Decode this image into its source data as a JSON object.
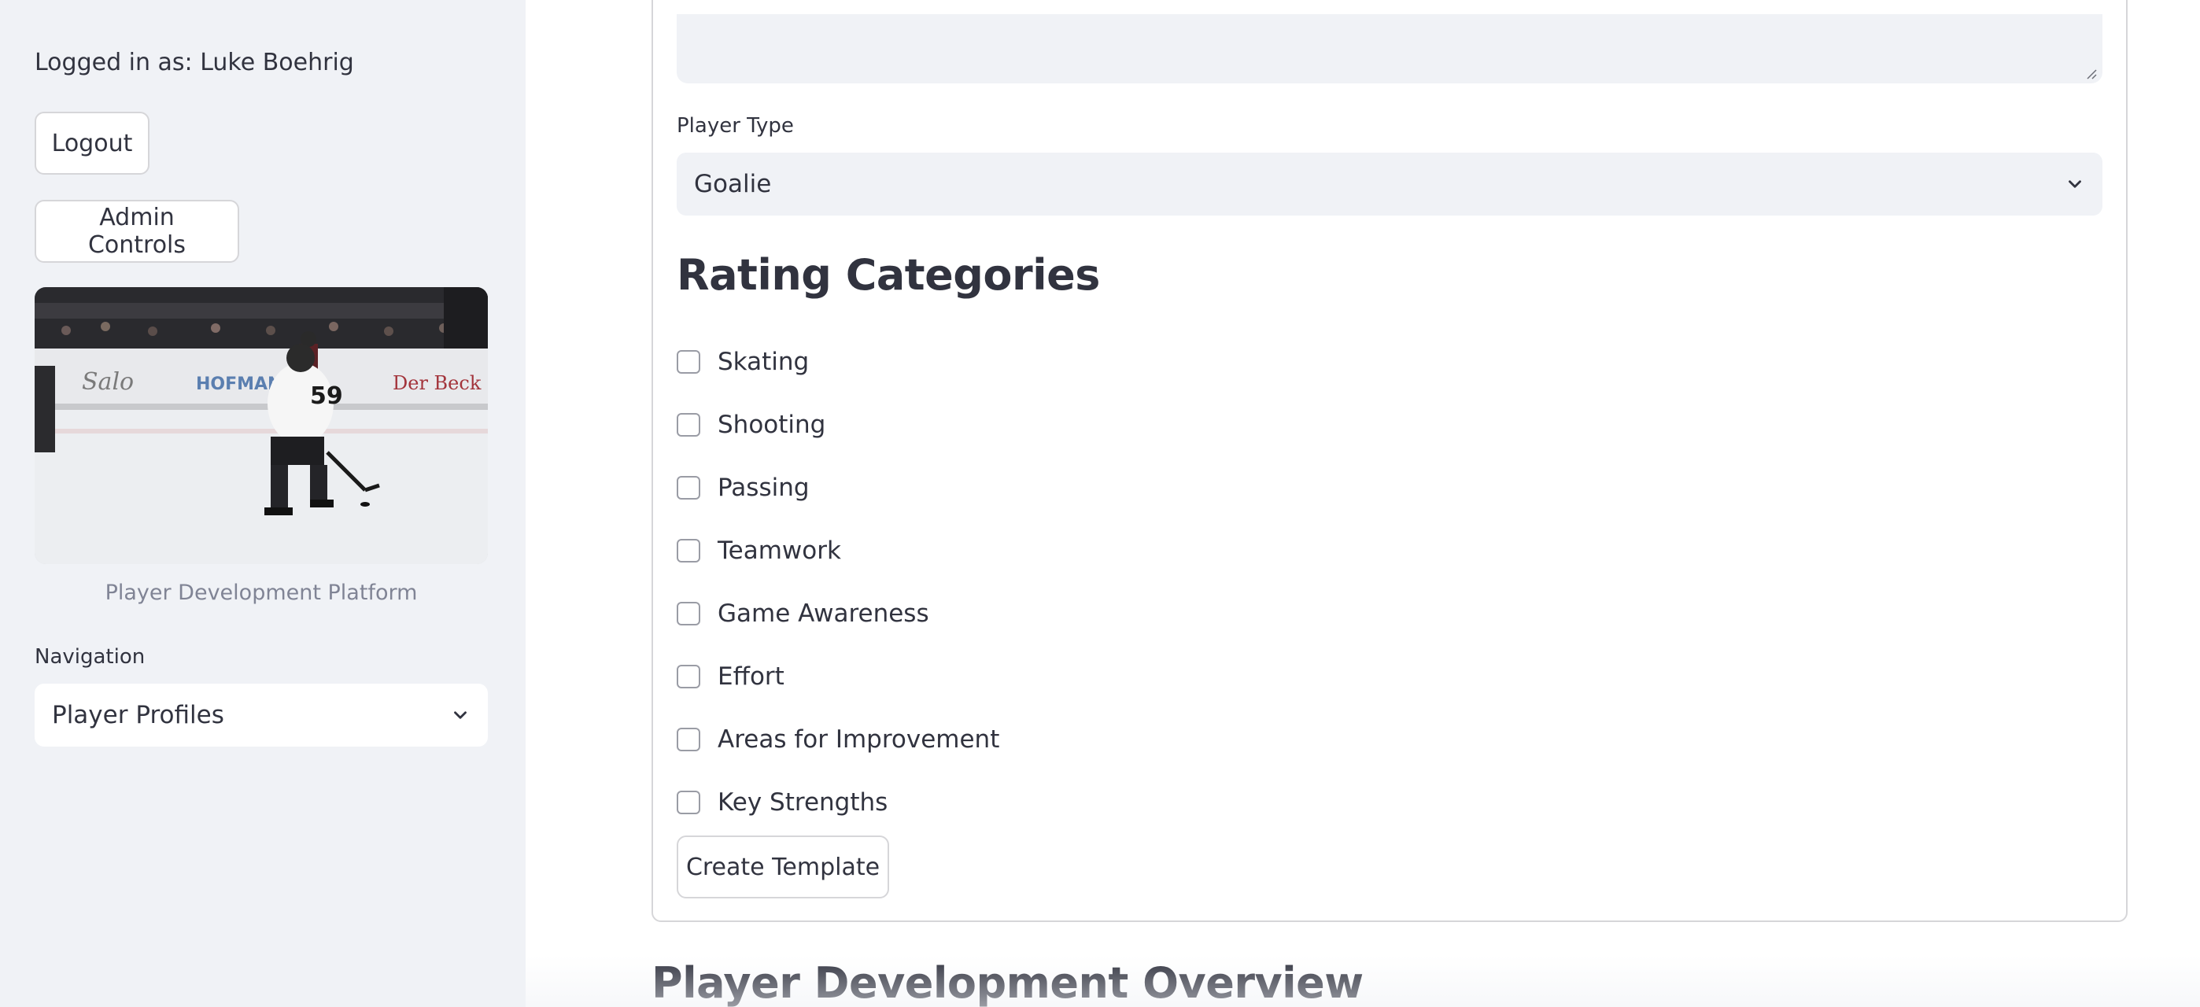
{
  "sidebar": {
    "logged_in_text": "Logged in as: Luke Boehrig",
    "logout_label": "Logout",
    "admin_label": "Admin Controls",
    "image_caption": "Player Development Platform",
    "navigation_label": "Navigation",
    "navigation_selected": "Player Profiles"
  },
  "form": {
    "player_type_label": "Player Type",
    "player_type_selected": "Goalie",
    "section_title": "Rating Categories",
    "categories": [
      {
        "label": "Skating",
        "checked": false
      },
      {
        "label": "Shooting",
        "checked": false
      },
      {
        "label": "Passing",
        "checked": false
      },
      {
        "label": "Teamwork",
        "checked": false
      },
      {
        "label": "Game Awareness",
        "checked": false
      },
      {
        "label": "Effort",
        "checked": false
      },
      {
        "label": "Areas for Improvement",
        "checked": false
      },
      {
        "label": "Key Strengths",
        "checked": false
      }
    ],
    "create_label": "Create Template"
  },
  "overview_title": "Player Development Overview",
  "colors": {
    "sidebar_bg": "#f0f2f6",
    "text": "#31333f",
    "muted_text": "#808495",
    "border": "#d6d6d9"
  },
  "icons": {
    "select_arrow": "chevron-down-icon",
    "textarea_grip": "resize-grip-icon"
  }
}
